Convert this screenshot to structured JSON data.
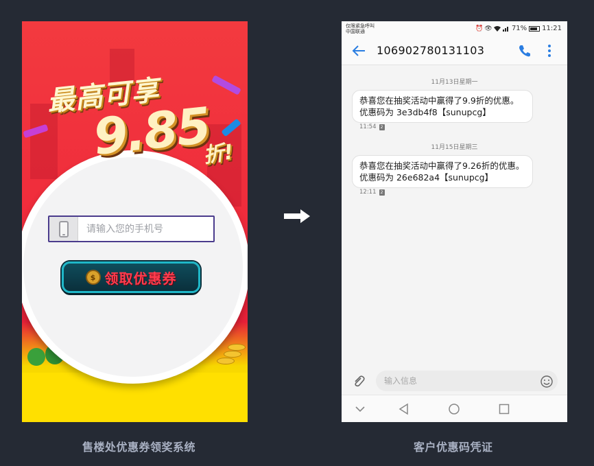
{
  "promo": {
    "headline": "最高可享",
    "discount": "9.85",
    "discount_unit": "折!",
    "phone_placeholder": "请输入您的手机号",
    "button_label": "领取优惠券",
    "caption": "售楼处优惠券领奖系统"
  },
  "sms": {
    "status": {
      "carrier_line1": "仅限紧急呼叫",
      "carrier_line2": "中国联通",
      "battery": "71%",
      "time": "11:21"
    },
    "sender": "106902780131103",
    "messages": [
      {
        "date": "11月13日星期一",
        "text": "恭喜您在抽奖活动中赢得了9.9折的优惠。优惠码为 3e3db4f8【sunupcg】",
        "time": "11:54",
        "sim": "2"
      },
      {
        "date": "11月15日星期三",
        "text": "恭喜您在抽奖活动中赢得了9.26折的优惠。优惠码为 26e682a4【sunupcg】",
        "time": "12:11",
        "sim": "2"
      }
    ],
    "input_placeholder": "输入信息",
    "caption": "客户优惠码凭证"
  },
  "colors": {
    "background": "#252a34",
    "promo_red": "#ef2a3b",
    "promo_yellow": "#ffe000",
    "accent_blue": "#2a7de1",
    "caption": "#a9b1c3"
  },
  "icons": [
    "phone-handset-icon",
    "money-bag-icon",
    "arrow-right-icon",
    "back-arrow-icon",
    "call-icon",
    "more-vert-icon",
    "attach-icon",
    "emoji-icon",
    "nav-back-icon",
    "nav-home-icon",
    "nav-recents-icon",
    "alarm-icon",
    "eye-icon",
    "wifi-icon",
    "signal-icon",
    "battery-icon"
  ]
}
